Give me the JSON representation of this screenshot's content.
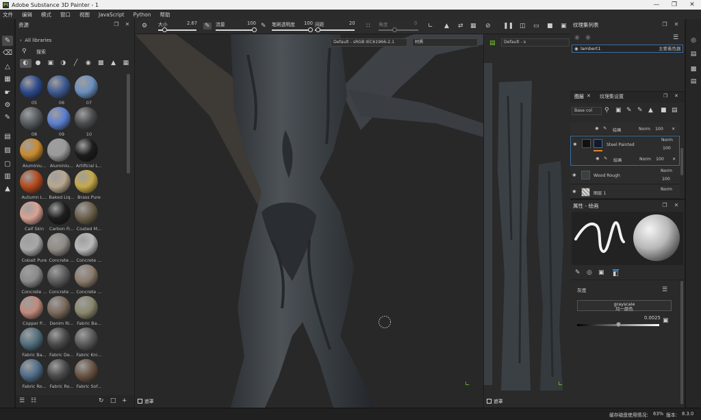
{
  "window": {
    "title": "Adobe Substance 3D Painter - 1",
    "logo": "Pt"
  },
  "menu": [
    "文件",
    "编辑",
    "模式",
    "窗口",
    "视图",
    "JavaScript",
    "Python",
    "帮助"
  ],
  "assets": {
    "title": "资源",
    "libraries": "All libraries",
    "search_label": "搜索",
    "items": [
      {
        "label": "05",
        "color": "#2c4a8c"
      },
      {
        "label": "06",
        "color": "#3e5a92"
      },
      {
        "label": "07",
        "color": "#6b8fbf"
      },
      {
        "label": "08",
        "color": "#555b5e"
      },
      {
        "label": "09",
        "color": "#5b7fcf"
      },
      {
        "label": "10",
        "color": "#4a4b4d"
      },
      {
        "label": "Aluminiu...",
        "color": "#c98a2e"
      },
      {
        "label": "Aluminiu...",
        "color": "#9a9a9a"
      },
      {
        "label": "Artificial L...",
        "color": "#1c1c1c"
      },
      {
        "label": "Autumn L...",
        "color": "#b44a1e"
      },
      {
        "label": "Baked Liq...",
        "color": "#b9a78f"
      },
      {
        "label": "Brass Pure",
        "color": "#c6a84a"
      },
      {
        "label": "Calf Skin",
        "color": "#d9a293"
      },
      {
        "label": "Carbon Fi...",
        "color": "#1e1e1e"
      },
      {
        "label": "Coated M...",
        "color": "#6b604a"
      },
      {
        "label": "Cobalt Pure",
        "color": "#a8a8a8"
      },
      {
        "label": "Concrete ...",
        "color": "#8f8b85"
      },
      {
        "label": "Concrete ...",
        "color": "#b9b9b9"
      },
      {
        "label": "Concrete ...",
        "color": "#8a8a8a"
      },
      {
        "label": "Concrete ...",
        "color": "#5c5c5c"
      },
      {
        "label": "Concrete ...",
        "color": "#8c7c6c"
      },
      {
        "label": "Copper P...",
        "color": "#c08a7a"
      },
      {
        "label": "Denim Ri...",
        "color": "#7a6a5c"
      },
      {
        "label": "Fabric Ba...",
        "color": "#8a876c"
      },
      {
        "label": "Fabric Ba...",
        "color": "#52707e"
      },
      {
        "label": "Fabric De...",
        "color": "#4a4a4a"
      },
      {
        "label": "Fabric Kni...",
        "color": "#5a5a5a"
      },
      {
        "label": "Fabric Ro...",
        "color": "#4f6d8a"
      },
      {
        "label": "Fabric Ro...",
        "color": "#4b4b4b"
      },
      {
        "label": "Fabric Sof...",
        "color": "#6b5444"
      }
    ]
  },
  "toolbar": {
    "size_label": "大小",
    "size_value": "2.67",
    "flow_label": "流量",
    "flow_value": "100",
    "opacity_label": "笔刷透明度",
    "opacity_value": "100",
    "spacing_label": "间距",
    "spacing_value": "20",
    "angle_label": "角度",
    "angle_value": "0"
  },
  "viewport": {
    "channel_select": "Default - sRGB IEC61966-2.1",
    "material_select": "材质",
    "uv_channel_select": "Default - s",
    "mask_label": "遮罩"
  },
  "texture_set": {
    "title": "纹理集列表",
    "row_name": "lambert1",
    "row_shader": "主要着色器"
  },
  "layers": {
    "tab_layers": "图层",
    "tab_settings": "纹理集设置",
    "channel_select": "Base col",
    "rows": [
      {
        "name": "绘画",
        "blend": "Norm",
        "opacity": "100"
      },
      {
        "name": "Steel Painted",
        "blend": "Norm",
        "opacity": "100"
      },
      {
        "name": "绘画",
        "blend": "Norm",
        "opacity": "100"
      },
      {
        "name": "Wood Rough",
        "blend": "Norm",
        "opacity": "100"
      },
      {
        "name": "图层 1",
        "blend": "Norm",
        "opacity": "100"
      }
    ]
  },
  "properties": {
    "title": "属性 - 绘画",
    "section": "灰度",
    "grayscale_title": "grayscale",
    "grayscale_sub": "均一颜色",
    "value": "0.0025"
  },
  "status": {
    "cache_label": "缓存磁盘使用情况:",
    "cache_value": "63%",
    "version_label": "版本:",
    "version_value": "8.3.0"
  }
}
